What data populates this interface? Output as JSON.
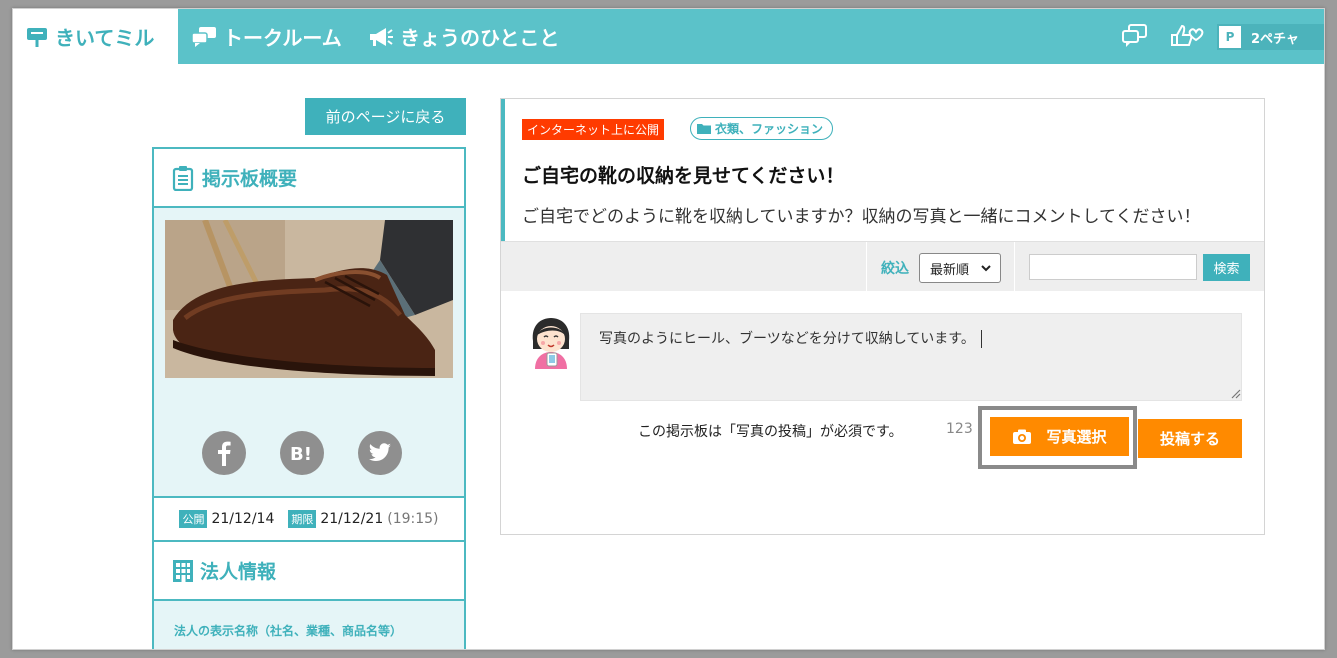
{
  "header": {
    "nav": [
      {
        "label": "きいてミル",
        "icon": "signboard-icon",
        "active": true
      },
      {
        "label": "トークルーム",
        "icon": "chat-bubbles-icon",
        "active": false
      },
      {
        "label": "きょうのひとこと",
        "icon": "megaphone-icon",
        "active": false
      }
    ],
    "user_initial": "P",
    "user_name": "2ペチャ"
  },
  "sidebar": {
    "back_label": "前のページに戻る",
    "board_title": "掲示板概要",
    "image_alt": "shoe-photo",
    "published_tag": "公開",
    "published_date": "21/12/14",
    "deadline_tag": "期限",
    "deadline_date": "21/12/21",
    "deadline_time": "(19:15)",
    "corp_title": "法人情報",
    "corp_label": "法人の表示名称（社名、業種、商品名等）"
  },
  "topic": {
    "visibility_badge": "インターネット上に公開",
    "category": "衣類、ファッション",
    "title": "ご自宅の靴の収納を見せてください！",
    "description": "ご自宅でどのように靴を収納していますか？収納の写真と一緒にコメントしてください！"
  },
  "filter": {
    "label": "絞込",
    "sort_selected": "最新順",
    "search_placeholder": "",
    "search_button": "検索"
  },
  "composer": {
    "comment_text": "写真のようにヒール、ブーツなどを分けて収納しています。",
    "required_note": "この掲示板は「写真の投稿」が必須です。",
    "char_count": "123",
    "photo_button": "写真選択",
    "post_button": "投稿する"
  },
  "colors": {
    "teal": "#5bc2c9",
    "teal_dark": "#3fb1bb",
    "orange": "#ff8a00",
    "red": "#ff3b00"
  }
}
